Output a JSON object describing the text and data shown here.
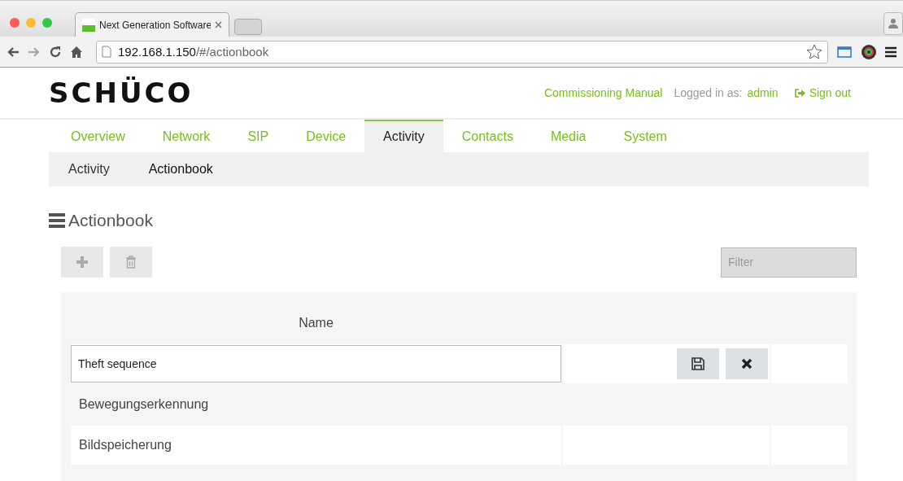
{
  "browser": {
    "tab_title": "Next Generation Software",
    "url_host": "192.168.1.150",
    "url_path": "/#/actionbook"
  },
  "header": {
    "logo": "SCHÜCO",
    "manual_link": "Commissioning Manual",
    "logged_in_label": "Logged in as:",
    "user": "admin",
    "sign_out": "Sign out"
  },
  "tabs": [
    {
      "label": "Overview",
      "selected": false
    },
    {
      "label": "Network",
      "selected": false
    },
    {
      "label": "SIP",
      "selected": false
    },
    {
      "label": "Device",
      "selected": false
    },
    {
      "label": "Activity",
      "selected": true
    },
    {
      "label": "Contacts",
      "selected": false
    },
    {
      "label": "Media",
      "selected": false
    },
    {
      "label": "System",
      "selected": false
    }
  ],
  "subtabs": [
    {
      "label": "Activity",
      "selected": false
    },
    {
      "label": "Actionbook",
      "selected": true
    }
  ],
  "page_title": "Actionbook",
  "filter": {
    "placeholder": "Filter"
  },
  "table": {
    "columns": [
      "Name"
    ],
    "rows": [
      {
        "kind": "edit",
        "value": "Theft sequence"
      },
      {
        "kind": "view",
        "name": "Bewegungserkennung"
      },
      {
        "kind": "view",
        "name": "Bildspeicherung"
      }
    ]
  }
}
